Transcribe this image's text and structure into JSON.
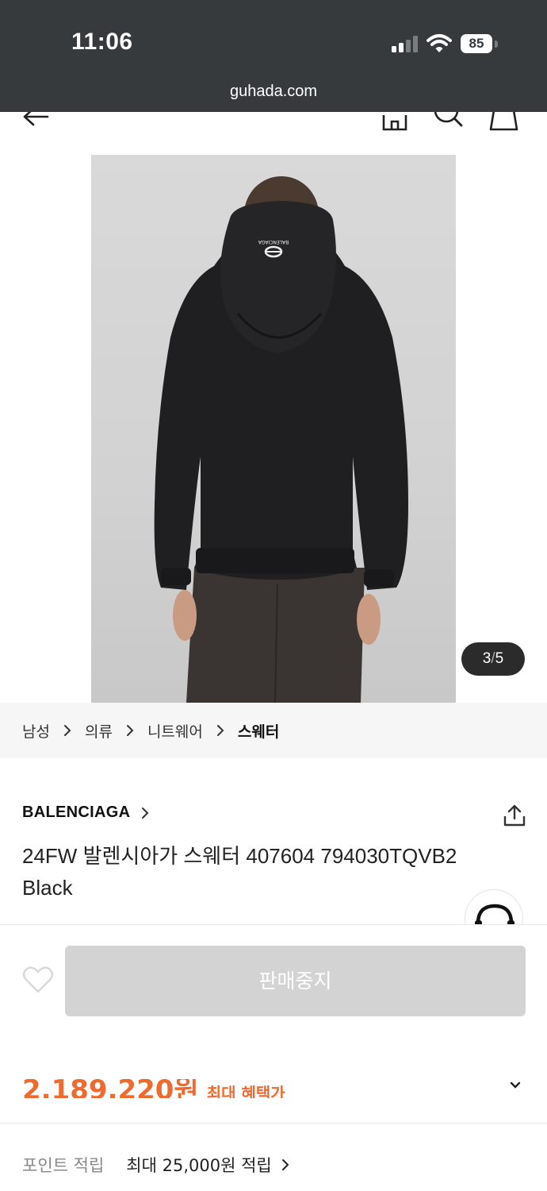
{
  "status_bar": {
    "time": "11:06",
    "battery": "85",
    "url": "guhada.com"
  },
  "header": {
    "back_icon": "arrow-left-icon",
    "home_icon": "home-icon",
    "search_icon": "search-icon",
    "bag_icon": "shopping-bag-icon"
  },
  "gallery": {
    "current": "3",
    "separator": "/",
    "total": "5",
    "logo_text": "BALENCIAGA"
  },
  "breadcrumb": [
    "남성",
    "의류",
    "니트웨어",
    "스웨터"
  ],
  "product": {
    "brand": "BALENCIAGA",
    "title": "24FW 발렌시아가 스웨터 407604 794030TQVB2 Black"
  },
  "actions": {
    "sold_out_label": "판매중지"
  },
  "price": {
    "amount": "2,189,220원",
    "label": "최대 혜택가"
  },
  "points": {
    "label": "포인트 적립",
    "value": "최대 25,000원 적립"
  },
  "colors": {
    "status_bg": "#363a3d",
    "accent": "#ef6a2e",
    "disabled_button": "#d3d3d3"
  }
}
